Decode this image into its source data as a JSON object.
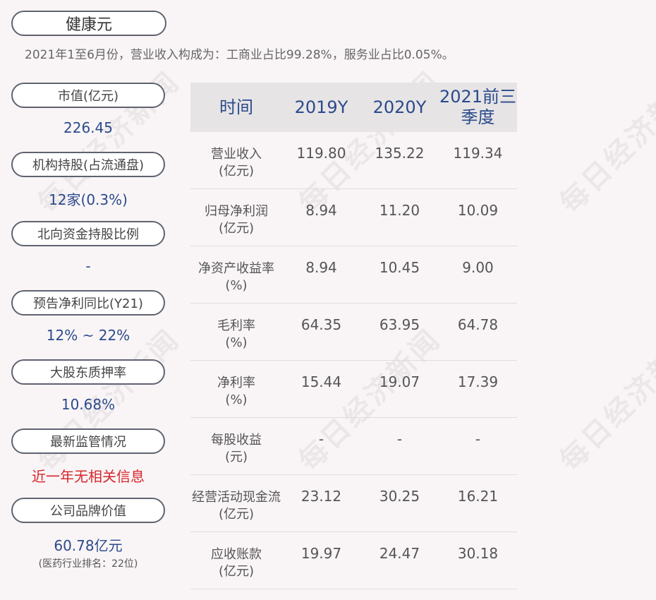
{
  "watermark": "每日经济新闻",
  "company": "健康元",
  "summary": "2021年1至6月份，营业收入构成为：工商业占比99.28%，服务业占比0.05%。",
  "metrics": [
    {
      "label": "市值(亿元)",
      "value": "226.45"
    },
    {
      "label": "机构持股(占流通盘)",
      "value": "12家(0.3%)"
    },
    {
      "label": "北向资金持股比例",
      "value": "-"
    },
    {
      "label": "预告净利同比(Y21)",
      "value": "12% ~ 22%"
    },
    {
      "label": "大股东质押率",
      "value": "10.68%"
    },
    {
      "label": "最新监管情况",
      "value": "近一年无相关信息"
    },
    {
      "label": "公司品牌价值",
      "value": "60.78亿元",
      "sub": "(医药行业排名：22位)"
    }
  ],
  "table": {
    "headers": [
      "时间",
      "2019Y",
      "2020Y",
      "2021前三季度"
    ],
    "rows": [
      {
        "label1": "营业收入",
        "label2": "(亿元)",
        "values": [
          "119.80",
          "135.22",
          "119.34"
        ]
      },
      {
        "label1": "归母净利润",
        "label2": "(亿元)",
        "values": [
          "8.94",
          "11.20",
          "10.09"
        ]
      },
      {
        "label1": "净资产收益率",
        "label2": "(%)",
        "values": [
          "8.94",
          "10.45",
          "9.00"
        ]
      },
      {
        "label1": "毛利率",
        "label2": "(%)",
        "values": [
          "64.35",
          "63.95",
          "64.78"
        ]
      },
      {
        "label1": "净利率",
        "label2": "(%)",
        "values": [
          "15.44",
          "19.07",
          "17.39"
        ]
      },
      {
        "label1": "每股收益",
        "label2": "(元)",
        "values": [
          "-",
          "-",
          "-"
        ]
      },
      {
        "label1": "经营活动现金流",
        "label2": "(亿元)",
        "values": [
          "23.12",
          "30.25",
          "16.21"
        ]
      },
      {
        "label1": "应收账款",
        "label2": "(亿元)",
        "values": [
          "19.97",
          "24.47",
          "30.18"
        ]
      }
    ]
  }
}
